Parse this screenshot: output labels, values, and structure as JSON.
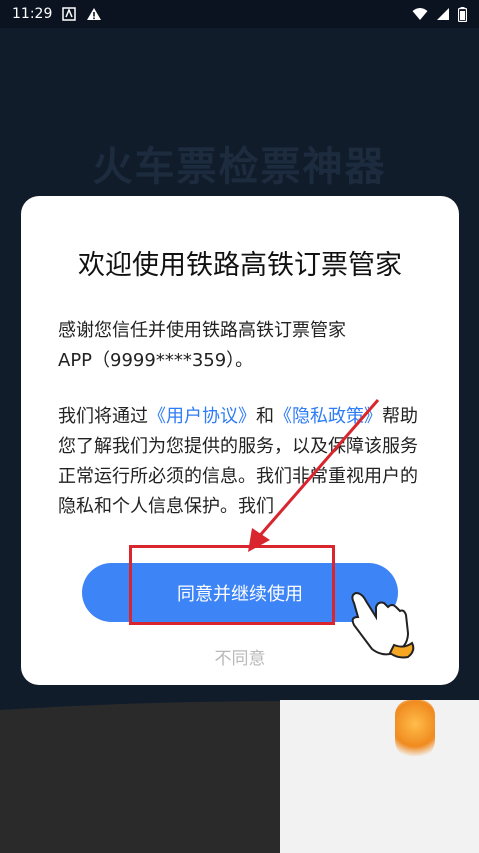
{
  "status_bar": {
    "time": "11:29",
    "icons": [
      "app-notification-icon",
      "warning-icon",
      "wifi-icon",
      "signal-icon",
      "battery-icon"
    ]
  },
  "background": {
    "title": "火车票检票神器"
  },
  "dialog": {
    "title": "欢迎使用铁路高铁订票管家",
    "para1_line1": "感谢您信任并使用铁路高铁订票管家",
    "para1_line2": "APP（9999****359）。",
    "para2_prefix": "我们将通过",
    "user_agreement_link": "《用户协议》",
    "para2_and": "和",
    "privacy_policy_link": "《隐私政策》",
    "para2_rest": "帮助您了解我们为您提供的服务，以及保障该服务正常运行所必须的信息。我们非常重视用户的隐私和个人信息保护。我们",
    "agree_button": "同意并继续使用",
    "disagree_button": "不同意"
  },
  "colors": {
    "accent": "#3d84f7",
    "link": "#2e7cf6",
    "highlight": "#d9252e"
  }
}
